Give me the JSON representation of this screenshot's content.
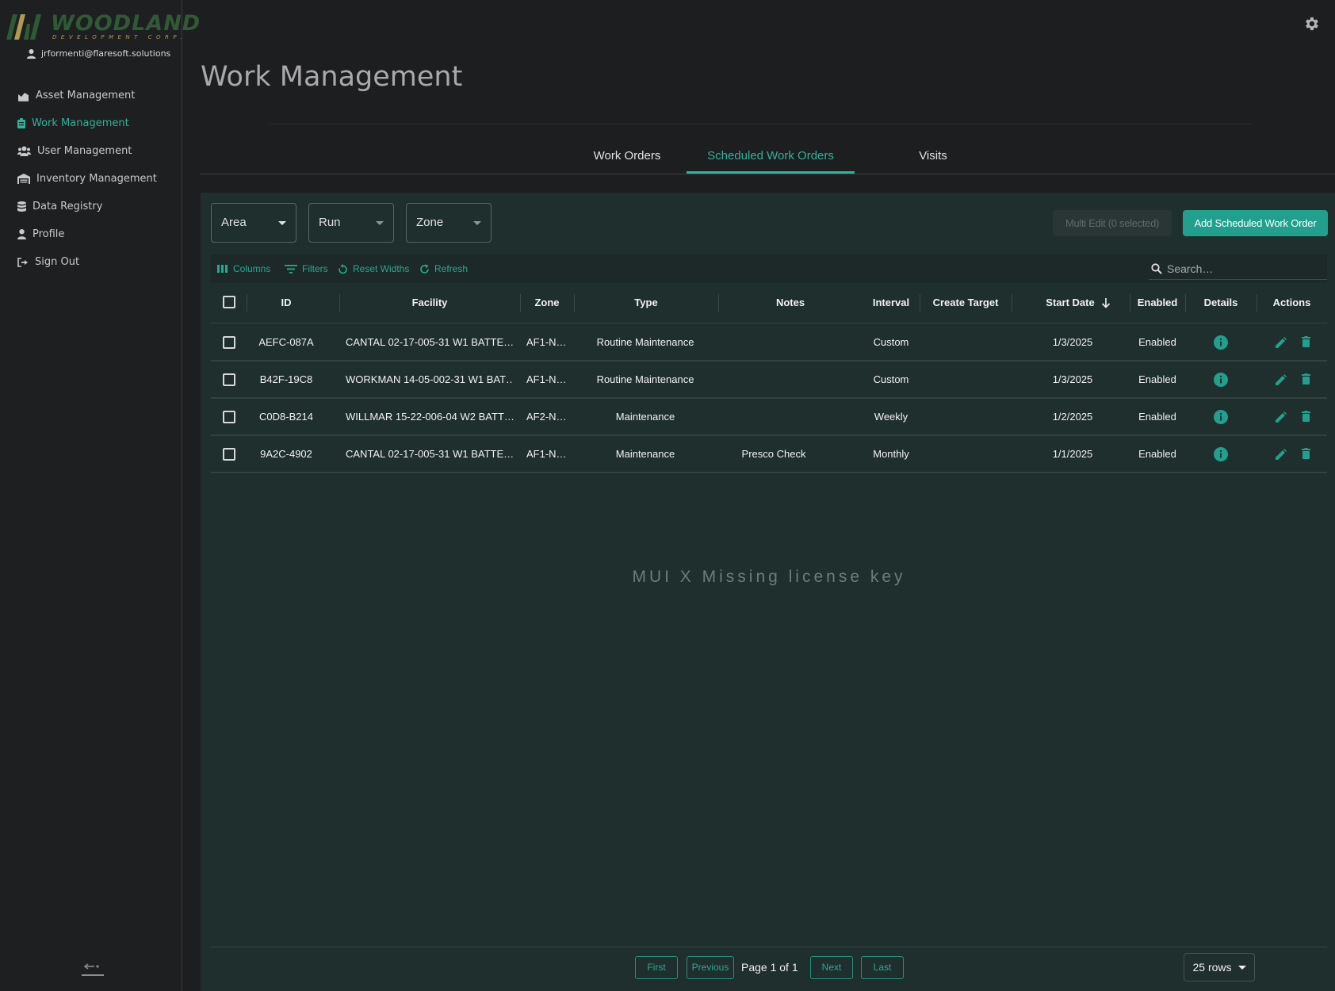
{
  "brand": {
    "name": "WOODLAND",
    "tagline": "DEVELOPMENT CORP.",
    "colors": {
      "primary": "#2f5a35",
      "accent": "#b09a52"
    }
  },
  "user": {
    "email": "jrformenti@flaresoft.solutions",
    "icon": "user-icon"
  },
  "sidebar": {
    "items": [
      {
        "label": "Asset Management",
        "icon": "asset-chart-icon",
        "active": false
      },
      {
        "label": "Work Management",
        "icon": "clipboard-icon",
        "active": true
      },
      {
        "label": "User Management",
        "icon": "users-icon",
        "active": false
      },
      {
        "label": "Inventory Management",
        "icon": "warehouse-icon",
        "active": false
      },
      {
        "label": "Data Registry",
        "icon": "database-icon",
        "active": false
      },
      {
        "label": "Profile",
        "icon": "user-icon",
        "active": false
      },
      {
        "label": "Sign Out",
        "icon": "sign-out-icon",
        "active": false
      }
    ],
    "collapse_icon": "collapse-sidebar-icon"
  },
  "header": {
    "title": "Work Management",
    "settings_icon": "gear-icon"
  },
  "tabs": [
    {
      "label": "Work Orders",
      "active": false
    },
    {
      "label": "Scheduled Work Orders",
      "active": true
    },
    {
      "label": "Visits",
      "active": false
    }
  ],
  "filters": [
    {
      "label": "Area"
    },
    {
      "label": "Run"
    },
    {
      "label": "Zone"
    }
  ],
  "actions": {
    "multi_edit": "Multi Edit (0 selected)",
    "add": "Add Scheduled Work Order"
  },
  "toolbar": {
    "columns": "Columns",
    "filters": "Filters",
    "reset_widths": "Reset Widths",
    "refresh": "Refresh",
    "search_placeholder": "Search…"
  },
  "table": {
    "columns": [
      "ID",
      "Facility",
      "Zone",
      "Type",
      "Notes",
      "Interval",
      "Create Target",
      "Start Date",
      "Enabled",
      "Details",
      "Actions"
    ],
    "sort": {
      "column": "Start Date",
      "direction": "descending"
    },
    "rows": [
      {
        "id": "AEFC-087A",
        "facility": "CANTAL 02-17-005-31 W1 BATTE…",
        "zone": "AF1-N…",
        "type": "Routine Maintenance",
        "notes": "",
        "interval": "Custom",
        "create_target": "",
        "start_date": "1/3/2025",
        "enabled": "Enabled"
      },
      {
        "id": "B42F-19C8",
        "facility": "WORKMAN 14-05-002-31 W1 BAT…",
        "zone": "AF1-N…",
        "type": "Routine Maintenance",
        "notes": "",
        "interval": "Custom",
        "create_target": "",
        "start_date": "1/3/2025",
        "enabled": "Enabled"
      },
      {
        "id": "C0D8-B214",
        "facility": "WILLMAR 15-22-006-04 W2 BATT…",
        "zone": "AF2-N…",
        "type": "Maintenance",
        "notes": "",
        "interval": "Weekly",
        "create_target": "",
        "start_date": "1/2/2025",
        "enabled": "Enabled"
      },
      {
        "id": "9A2C-4902",
        "facility": "CANTAL 02-17-005-31 W1 BATTE…",
        "zone": "AF1-N…",
        "type": "Maintenance",
        "notes": "Presco Check",
        "interval": "Monthly",
        "create_target": "",
        "start_date": "1/1/2025",
        "enabled": "Enabled"
      }
    ]
  },
  "watermark": "MUI X Missing license key",
  "pagination": {
    "first": "First",
    "previous": "Previous",
    "label": "Page 1 of 1",
    "next": "Next",
    "last": "Last",
    "rows_per_page": "25 rows"
  },
  "colors": {
    "accent": "#2fb39a",
    "button": "#21a08d",
    "background": "#1d1e20",
    "panel": "#1f2f2e"
  }
}
